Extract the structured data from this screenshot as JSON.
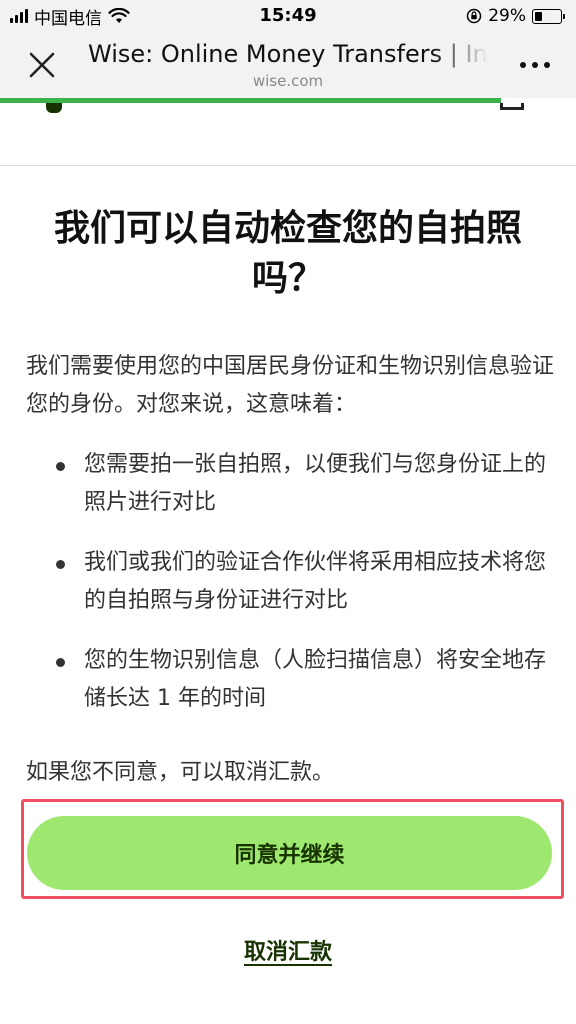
{
  "status_bar": {
    "carrier": "中国电信",
    "time": "15:49",
    "battery": "29%",
    "battery_level": 0.29,
    "icons": [
      "signal-icon",
      "wifi-icon",
      "orientation-lock-icon",
      "battery-icon"
    ]
  },
  "browser": {
    "title": "Wise: Online Money Transfers | International Banking Features",
    "domain": "wise.com",
    "close_icon": "close-icon",
    "more_icon": "more-icon",
    "load_progress": 0.87,
    "progress_color": "#3bb34a"
  },
  "content": {
    "heading": "我们可以自动检查您的自拍照吗？",
    "intro": "我们需要使用您的中国居民身份证和生物识别信息验证您的身份。对您来说，这意味着：",
    "bullets": [
      "您需要拍一张自拍照，以便我们与您身份证上的照片进行对比",
      "我们或我们的验证合作伙伴将采用相应技术将您的自拍照与身份证进行对比",
      "您的生物识别信息（人脸扫描信息）将安全地存储长达 1 年的时间"
    ],
    "note": "如果您不同意，可以取消汇款。"
  },
  "actions": {
    "agree_label": "同意并继续",
    "cancel_label": "取消汇款"
  },
  "colors": {
    "primary_button": "#9fe870",
    "primary_text": "#163300",
    "highlight_border": "#ef4f5f"
  }
}
